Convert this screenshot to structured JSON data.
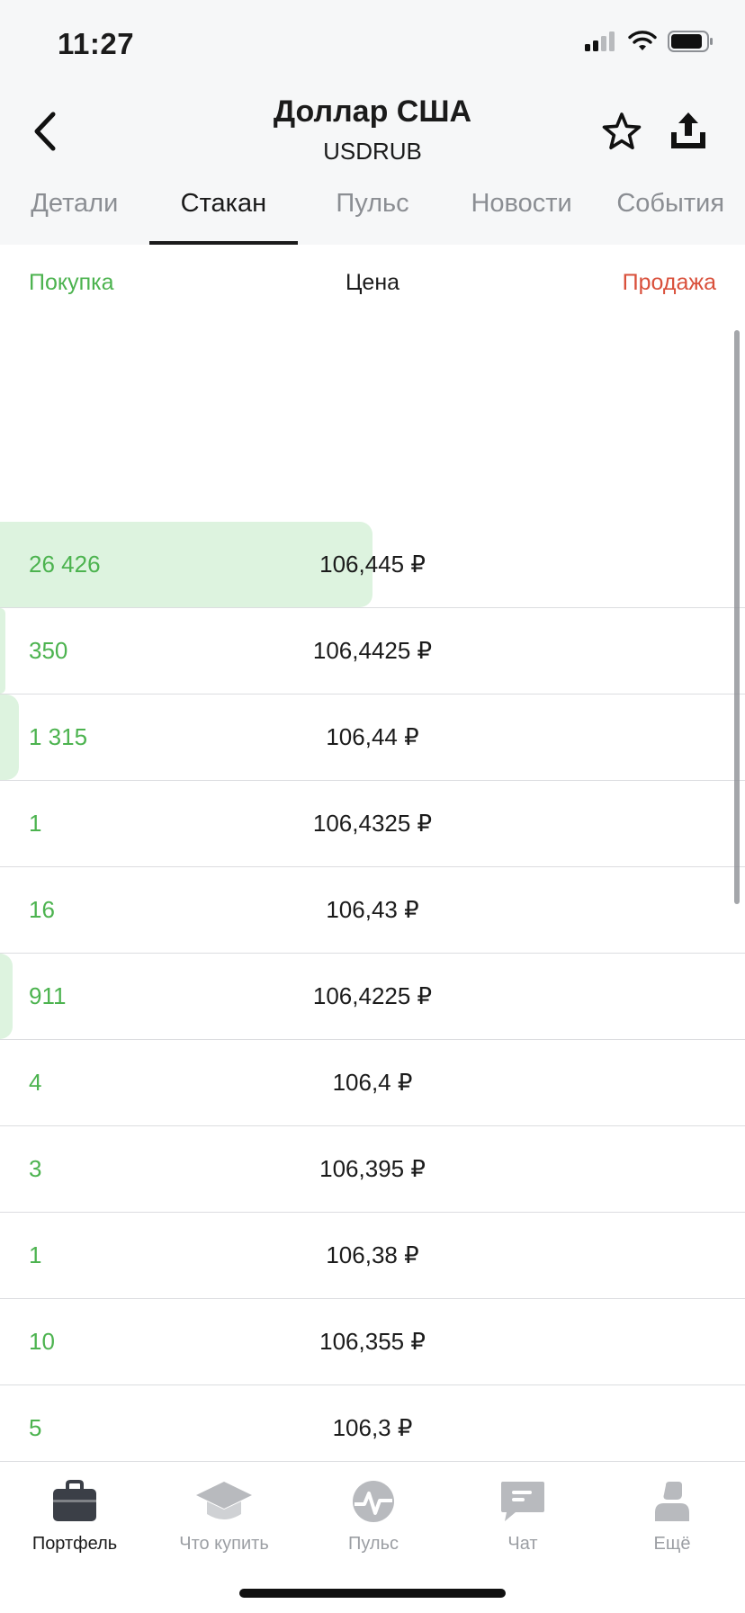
{
  "status": {
    "time": "11:27"
  },
  "header": {
    "title": "Доллар США",
    "ticker": "USDRUB"
  },
  "tabs": [
    {
      "label": "Детали",
      "active": false
    },
    {
      "label": "Стакан",
      "active": true
    },
    {
      "label": "Пульс",
      "active": false
    },
    {
      "label": "Новости",
      "active": false
    },
    {
      "label": "События",
      "active": false
    }
  ],
  "columns": {
    "buy": "Покупка",
    "price": "Цена",
    "sell": "Продажа"
  },
  "colors": {
    "buy": "#4cb34f",
    "sell": "#d9503b",
    "bar": "#ddf3df"
  },
  "orderbook": [
    {
      "qty": "26 426",
      "price": "106,445 ₽",
      "depth": 1.0
    },
    {
      "qty": "350",
      "price": "106,4425 ₽",
      "depth": 0.013
    },
    {
      "qty": "1 315",
      "price": "106,44 ₽",
      "depth": 0.05
    },
    {
      "qty": "1",
      "price": "106,4325 ₽",
      "depth": 0.0
    },
    {
      "qty": "16",
      "price": "106,43 ₽",
      "depth": 0.0
    },
    {
      "qty": "911",
      "price": "106,4225 ₽",
      "depth": 0.034
    },
    {
      "qty": "4",
      "price": "106,4 ₽",
      "depth": 0.0
    },
    {
      "qty": "3",
      "price": "106,395 ₽",
      "depth": 0.0
    },
    {
      "qty": "1",
      "price": "106,38 ₽",
      "depth": 0.0
    },
    {
      "qty": "10",
      "price": "106,355 ₽",
      "depth": 0.0
    },
    {
      "qty": "5",
      "price": "106,3 ₽",
      "depth": 0.0
    }
  ],
  "tabbar": [
    {
      "label": "Портфель",
      "icon": "briefcase-icon",
      "active": true
    },
    {
      "label": "Что купить",
      "icon": "graduation-cap-icon",
      "active": false
    },
    {
      "label": "Пульс",
      "icon": "pulse-icon",
      "active": false
    },
    {
      "label": "Чат",
      "icon": "chat-icon",
      "active": false
    },
    {
      "label": "Ещё",
      "icon": "profile-icon",
      "active": false
    }
  ]
}
